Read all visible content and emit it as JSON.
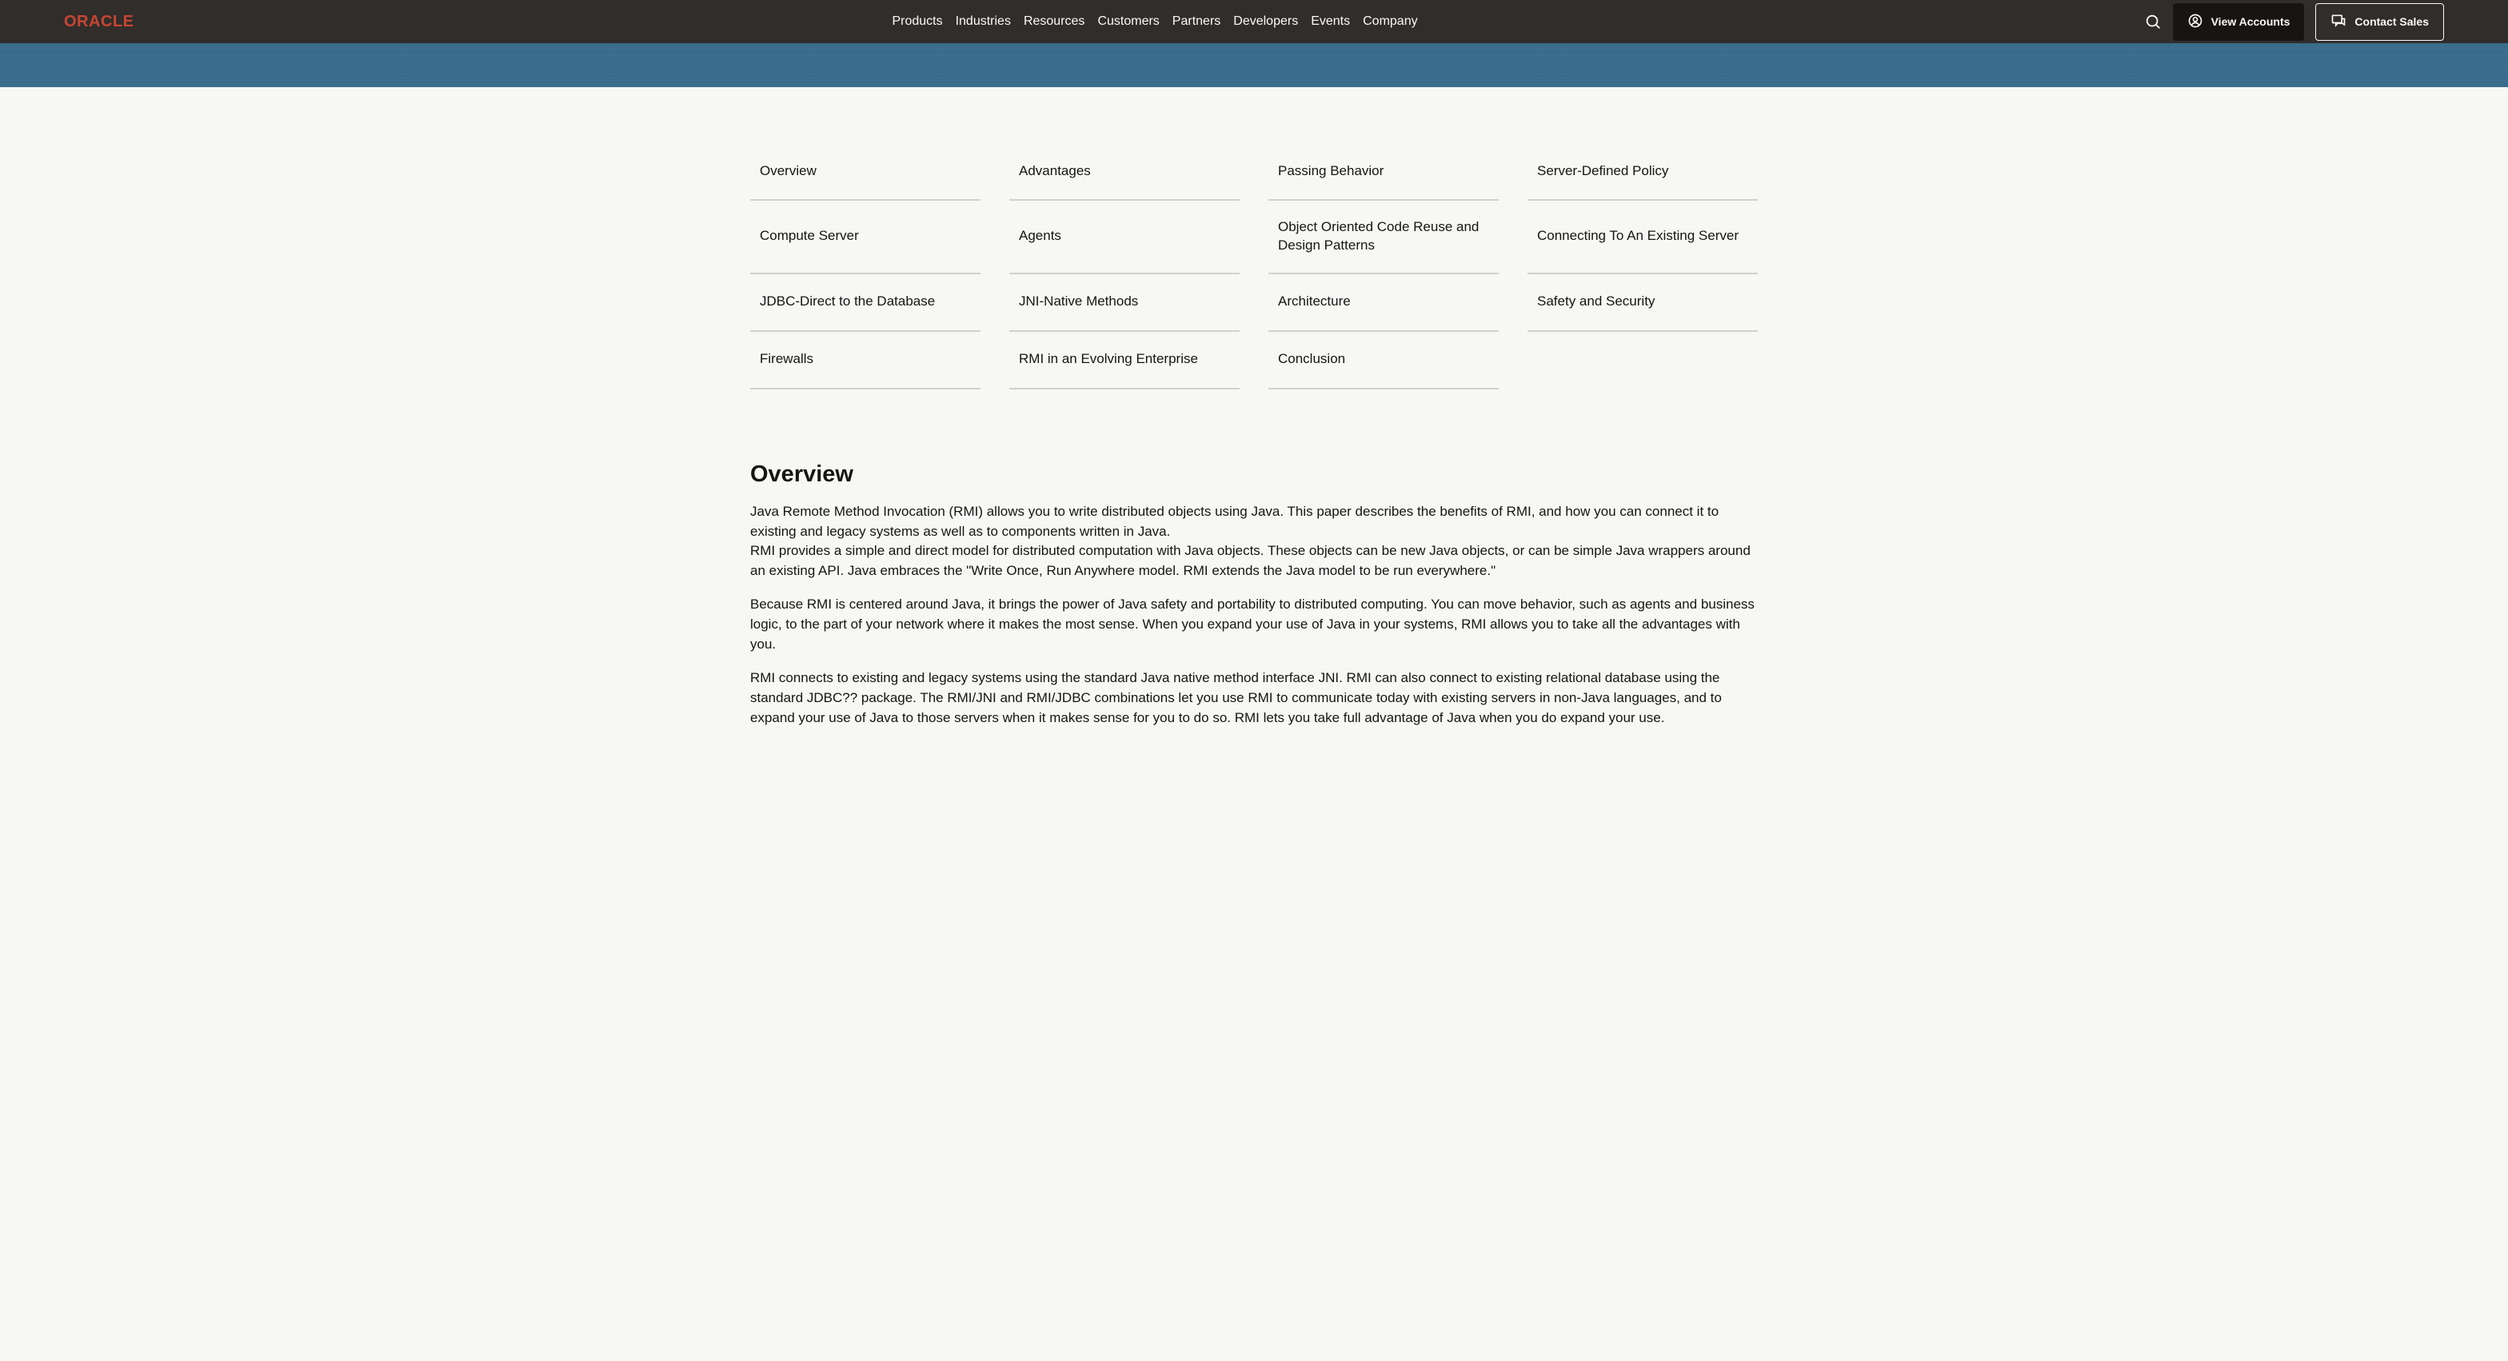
{
  "header": {
    "logo": "ORACLE",
    "nav": [
      "Products",
      "Industries",
      "Resources",
      "Customers",
      "Partners",
      "Developers",
      "Events",
      "Company"
    ],
    "view_accounts": "View Accounts",
    "contact_sales": "Contact Sales"
  },
  "toc": [
    "Overview",
    "Advantages",
    "Passing Behavior",
    "Server-Defined Policy",
    "Compute Server",
    "Agents",
    "Object Oriented Code Reuse and Design Patterns",
    "Connecting To An Existing Server",
    "JDBC-Direct to the Database",
    "JNI-Native Methods",
    "Architecture",
    "Safety and Security",
    "Firewalls",
    "RMI in an Evolving Enterprise",
    "Conclusion"
  ],
  "article": {
    "heading": "Overview",
    "p1": "Java Remote Method Invocation (RMI) allows you to write distributed objects using Java. This paper describes the benefits of RMI, and how you can connect it to existing and legacy systems as well as to components written in Java.",
    "p2": "RMI provides a simple and direct model for distributed computation with Java objects. These objects can be new Java objects, or can be simple Java wrappers around an existing API. Java embraces the \"Write Once, Run Anywhere model. RMI extends the Java model to be run everywhere.\"",
    "p3": "Because RMI is centered around Java, it brings the power of Java safety and portability to distributed computing. You can move behavior, such as agents and business logic, to the part of your network where it makes the most sense. When you expand your use of Java in your systems, RMI allows you to take all the advantages with you.",
    "p4": "RMI connects to existing and legacy systems using the standard Java native method interface JNI. RMI can also connect to existing relational database using the standard JDBC?? package. The RMI/JNI and RMI/JDBC combinations let you use RMI to communicate today with existing servers in non-Java languages, and to expand your use of Java to those servers when it makes sense for you to do so. RMI lets you take full advantage of Java when you do expand your use."
  }
}
